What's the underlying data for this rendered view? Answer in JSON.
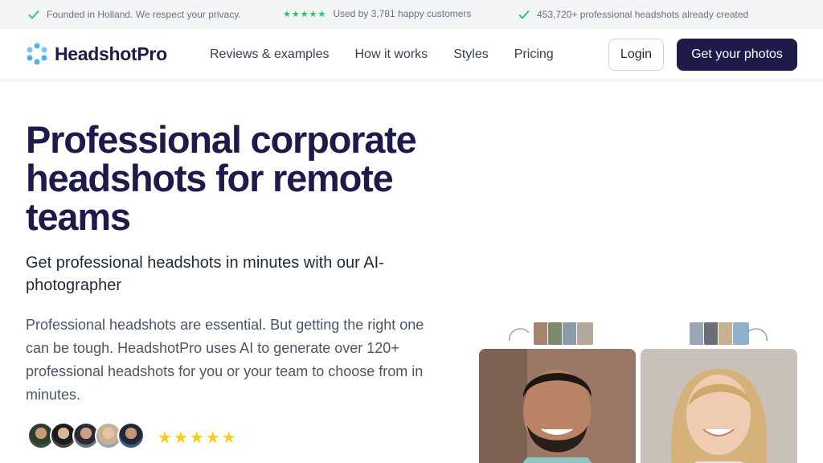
{
  "topbar": {
    "item1": "Founded in Holland. We respect your privacy.",
    "item2_stars": "★★★★★",
    "item2": "Used by 3,781 happy customers",
    "item3": "453,720+ professional headshots already created"
  },
  "brand": {
    "name": "HeadshotPro",
    "color": "#1e1b4b",
    "accent": "#4fb3e8"
  },
  "nav": {
    "reviews": "Reviews & examples",
    "how": "How it works",
    "styles": "Styles",
    "pricing": "Pricing",
    "login": "Login",
    "cta": "Get your photos"
  },
  "hero": {
    "title": "Professional corporate headshots for remote teams",
    "subtitle": "Get professional headshots in minutes with our AI-photographer",
    "description": "Professional headshots are essential. But getting the right one can be tough. HeadshotPro uses AI to generate over 120+ professional headshots for you or your team to choose from in minutes.",
    "rating_stars": "★★★★★"
  },
  "colors": {
    "check": "#22c55e",
    "star": "#facc15",
    "cta_bg": "#1e1b4b"
  }
}
